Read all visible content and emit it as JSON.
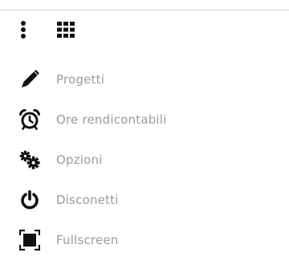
{
  "colors": {
    "icon": "#111111",
    "label": "#9b9b9b",
    "divider": "#d6d6d6"
  },
  "toolbar": {
    "more_icon": "kebab-vertical-icon",
    "apps_icon": "apps-grid-icon"
  },
  "menu": {
    "items": [
      {
        "label": "Progetti",
        "icon": "pencil-icon"
      },
      {
        "label": "Ore rendicontabili",
        "icon": "alarm-clock-icon"
      },
      {
        "label": "Opzioni",
        "icon": "gears-icon"
      },
      {
        "label": "Disconetti",
        "icon": "power-icon"
      },
      {
        "label": "Fullscreen",
        "icon": "fullscreen-icon"
      }
    ]
  }
}
